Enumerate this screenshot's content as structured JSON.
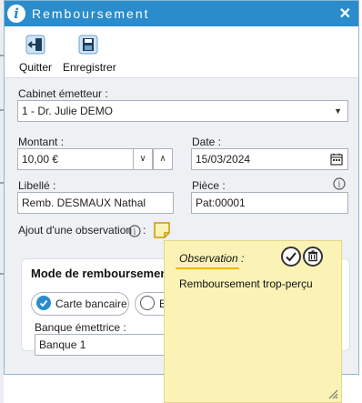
{
  "window": {
    "title": "Remboursement",
    "close_glyph": "✕",
    "info_glyph": "i"
  },
  "toolbar": {
    "quit_label": "Quitter",
    "save_label": "Enregistrer"
  },
  "form": {
    "cabinet_label": "Cabinet émetteur :",
    "cabinet_value": "1 - Dr. Julie DEMO",
    "montant_label": "Montant :",
    "montant_value": "10,00 €",
    "date_label": "Date :",
    "date_value": "15/03/2024",
    "libelle_label": "Libellé :",
    "libelle_value": "Remb. DESMAUX Nathal",
    "piece_label": "Pièce :",
    "piece_value": "Pat:00001",
    "observation_label": "Ajout d'une observation",
    "observation_colon": ":"
  },
  "mode": {
    "title": "Mode de remboursement",
    "options": [
      "Carte bancaire",
      "Esp"
    ],
    "selected": "Carte bancaire",
    "bank_label": "Banque émettrice :",
    "bank_value": "Banque  1"
  },
  "note": {
    "title": "Observation :",
    "text": "Remboursement trop-perçu"
  },
  "colors": {
    "titlebar": "#2a8ccb",
    "accent": "#2a8ccb",
    "note_bg": "#fbf3b6"
  }
}
